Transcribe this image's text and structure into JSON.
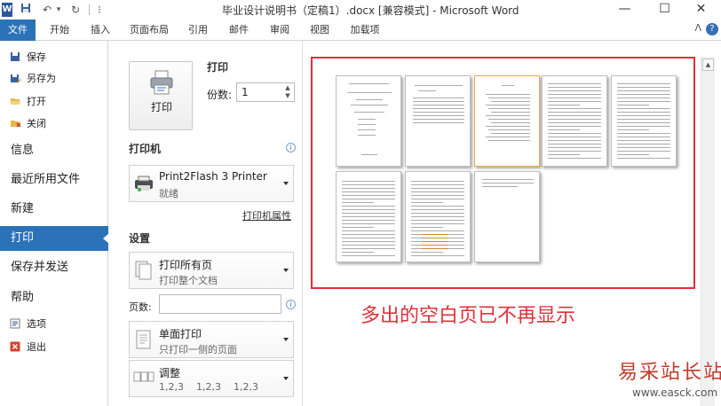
{
  "window": {
    "title": "毕业设计说明书（定稿1）.docx [兼容模式] - Microsoft Word",
    "app_icon": "W",
    "minimize_icon": "—",
    "maximize_icon": "☐",
    "close_icon": "✕"
  },
  "quick_access": {
    "save_icon": "💾",
    "undo_icon": "↶",
    "undo_dropdown": "▾",
    "redo_icon": "↻",
    "customize_icon": "⁝"
  },
  "ribbon": {
    "tabs": [
      "文件",
      "开始",
      "插入",
      "页面布局",
      "引用",
      "邮件",
      "审阅",
      "视图",
      "加载项"
    ],
    "collapse_icon": "ᐱ",
    "help_icon": "?"
  },
  "backstage_nav": {
    "save": "保存",
    "save_as": "另存为",
    "open": "打开",
    "close": "关闭",
    "info": "信息",
    "recent": "最近所用文件",
    "new": "新建",
    "print": "打印",
    "save_send": "保存并发送",
    "help": "帮助",
    "options": "选项",
    "exit": "退出"
  },
  "print_panel": {
    "print_button": "打印",
    "heading": "打印",
    "copies_label": "份数:",
    "copies_value": "1",
    "spin_up": "▲",
    "spin_down": "▼",
    "printer_section": "打印机",
    "printer_name": "Print2Flash 3 Printer",
    "printer_status": "就绪",
    "printer_properties": "打印机属性",
    "settings_section": "设置",
    "range_main": "打印所有页",
    "range_sub": "打印整个文档",
    "pages_label": "页数:",
    "pages_value": "",
    "sides_main": "单面打印",
    "sides_sub": "只打印一侧的页面",
    "collate_main": "调整",
    "collate_sub": "1,2,3    1,2,3    1,2,3"
  },
  "preview": {
    "page_count": 8,
    "scroll_up_icon": "▲"
  },
  "annotation": "多出的空白页已不再显示",
  "watermark": {
    "title": "易采站长站",
    "url": "www.easck.com"
  },
  "colors": {
    "accent": "#2b72b8",
    "highlight_red": "#e0303a",
    "watermark_red": "#c13b2a"
  }
}
